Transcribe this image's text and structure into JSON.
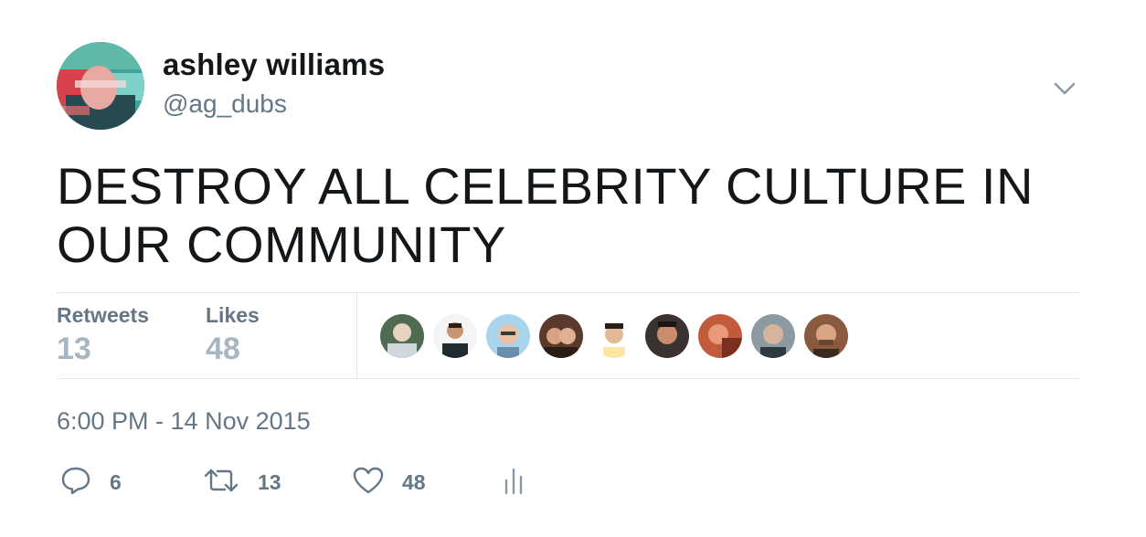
{
  "tweet": {
    "author_name": "ashley williams",
    "author_handle": "@ag_dubs",
    "text": "DESTROY ALL CELEBRITY CULTURE IN OUR COMMUNITY",
    "timestamp": "6:00 PM - 14 Nov 2015"
  },
  "stats": {
    "retweets_label": "Retweets",
    "retweets_value": "13",
    "likes_label": "Likes",
    "likes_value": "48"
  },
  "likers": [
    {
      "icon": "avatar"
    },
    {
      "icon": "avatar"
    },
    {
      "icon": "avatar"
    },
    {
      "icon": "avatar"
    },
    {
      "icon": "avatar"
    },
    {
      "icon": "avatar"
    },
    {
      "icon": "avatar"
    },
    {
      "icon": "avatar"
    },
    {
      "icon": "avatar"
    }
  ],
  "actions": {
    "reply_count": "6",
    "retweet_count": "13",
    "like_count": "48"
  },
  "icons": {
    "caret": "chevron-down-icon",
    "reply": "reply-icon",
    "retweet": "retweet-icon",
    "like": "heart-icon",
    "analytics": "analytics-icon"
  },
  "colors": {
    "text": "#14171a",
    "secondary": "#657786",
    "muted_value": "#a8b6c2",
    "divider": "#e1e8ed"
  }
}
